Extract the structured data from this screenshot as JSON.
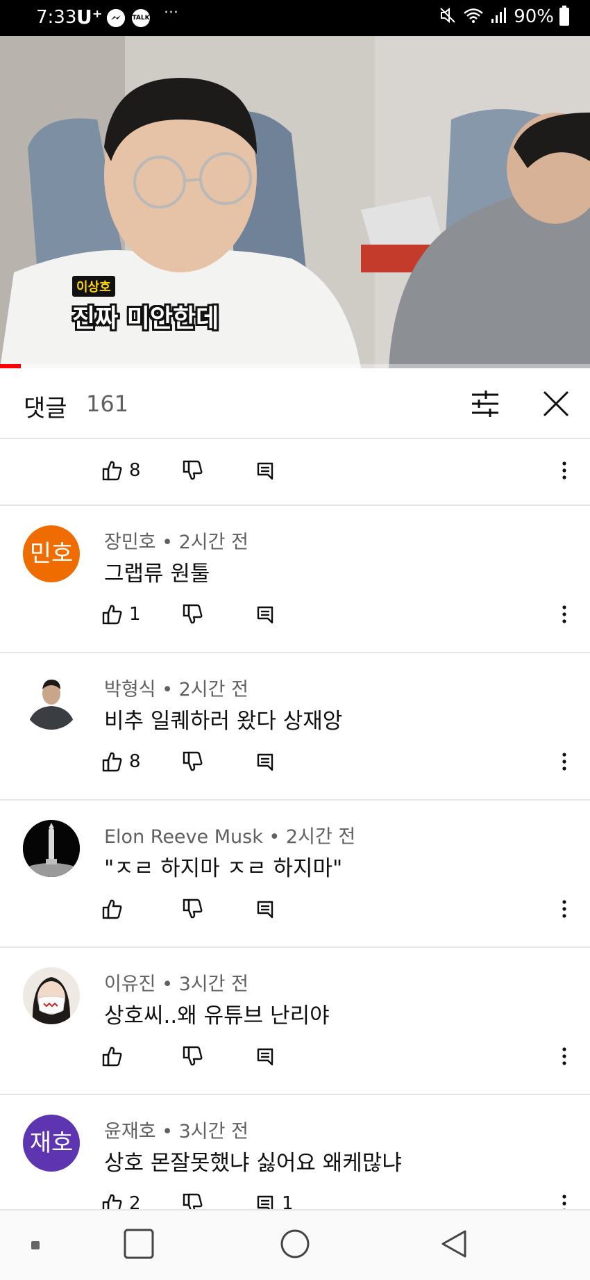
{
  "status_bar": {
    "time": "7:33",
    "carrier": "U⁺",
    "talk_icon_label": "TALK",
    "battery": "90%",
    "icons": [
      "messenger-icon",
      "talk-icon",
      "more-icon",
      "mute-icon",
      "wifi-icon",
      "signal-icon",
      "battery-icon"
    ]
  },
  "video": {
    "caption_name": "이상호",
    "caption_text": "진짜 미안한데",
    "progress": 0.035,
    "colors": {
      "progress": "#ff0000"
    }
  },
  "comments_header": {
    "title": "댓글",
    "count": "161",
    "icons": [
      "filter-icon",
      "close-icon"
    ]
  },
  "comments": [
    {
      "author": "",
      "time": "",
      "text": "",
      "likes": "8",
      "replies": ""
    },
    {
      "author": "장민호",
      "time": "2시간 전",
      "text": "그랩류 원툴",
      "likes": "1",
      "replies": "",
      "avatar_text": "민호",
      "avatar_color": "#ef6c00"
    },
    {
      "author": "박형식",
      "time": "2시간 전",
      "text": "비추 일퀘하러 왔다 상재앙",
      "likes": "8",
      "replies": "",
      "avatar": "person-photo"
    },
    {
      "author": "Elon Reeve Musk",
      "time": "2시간 전",
      "text": "\"ㅈㄹ 하지마 ㅈㄹ 하지마\"",
      "likes": "",
      "replies": "",
      "avatar": "rocket-photo"
    },
    {
      "author": "이유진",
      "time": "3시간 전",
      "text": "상호씨..왜 유튜브 난리야",
      "likes": "",
      "replies": "",
      "avatar": "mask-photo"
    },
    {
      "author": "윤재호",
      "time": "3시간 전",
      "text": "상호 몬잘못했냐 싫어요 왜케많냐",
      "likes": "2",
      "replies": "1",
      "avatar_text": "재호",
      "avatar_color": "#5e35b1"
    }
  ],
  "separator": " • ",
  "nav_bar": {
    "icons": [
      "dot-icon",
      "recent-apps-icon",
      "home-icon",
      "back-icon"
    ]
  }
}
